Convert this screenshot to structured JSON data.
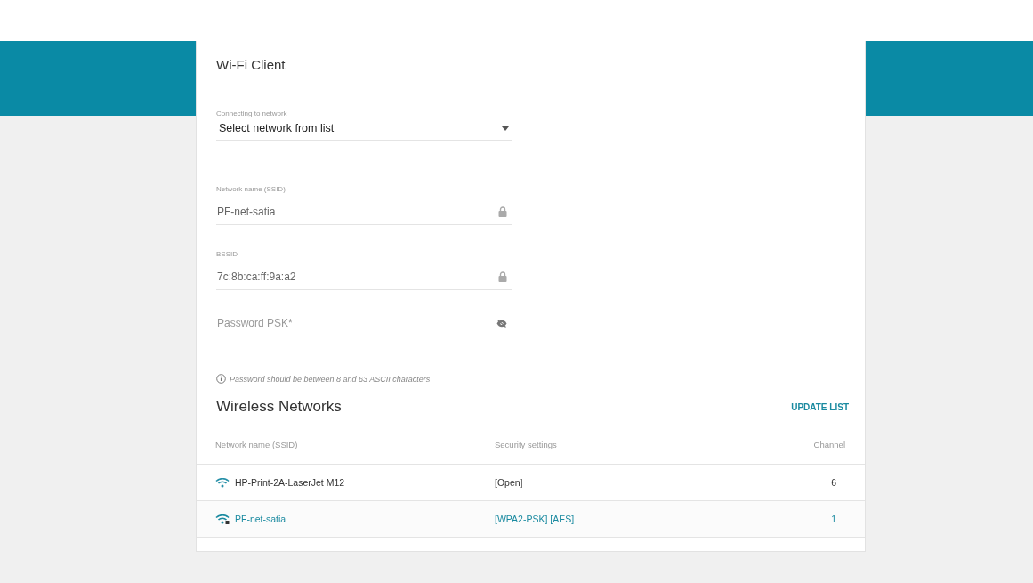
{
  "panel": {
    "title": "Wi-Fi Client",
    "network_select": {
      "label": "Connecting to network",
      "value": "Select network from list"
    },
    "fields": [
      {
        "label": "Network name (SSID)",
        "value": "PF-net-satia",
        "kind": "locked"
      },
      {
        "label": "BSSID",
        "value": "7c:8b:ca:ff:9a:a2",
        "kind": "locked"
      },
      {
        "placeholder": "Password PSK*",
        "kind": "password"
      }
    ],
    "hint": "Password should be between 8 and 63 ASCII characters"
  },
  "wireless_networks": {
    "title": "Wireless Networks",
    "update_button": "UPDATE LIST",
    "columns": [
      "Network name (SSID)",
      "Security settings",
      "Channel"
    ],
    "rows": [
      {
        "ssid": "HP-Print-2A-LaserJet M12",
        "security": "[Open]",
        "channel": "6",
        "secured": false,
        "selected": false
      },
      {
        "ssid": "PF-net-satia",
        "security": "[WPA2-PSK] [AES]",
        "channel": "1",
        "secured": true,
        "selected": true
      }
    ]
  }
}
